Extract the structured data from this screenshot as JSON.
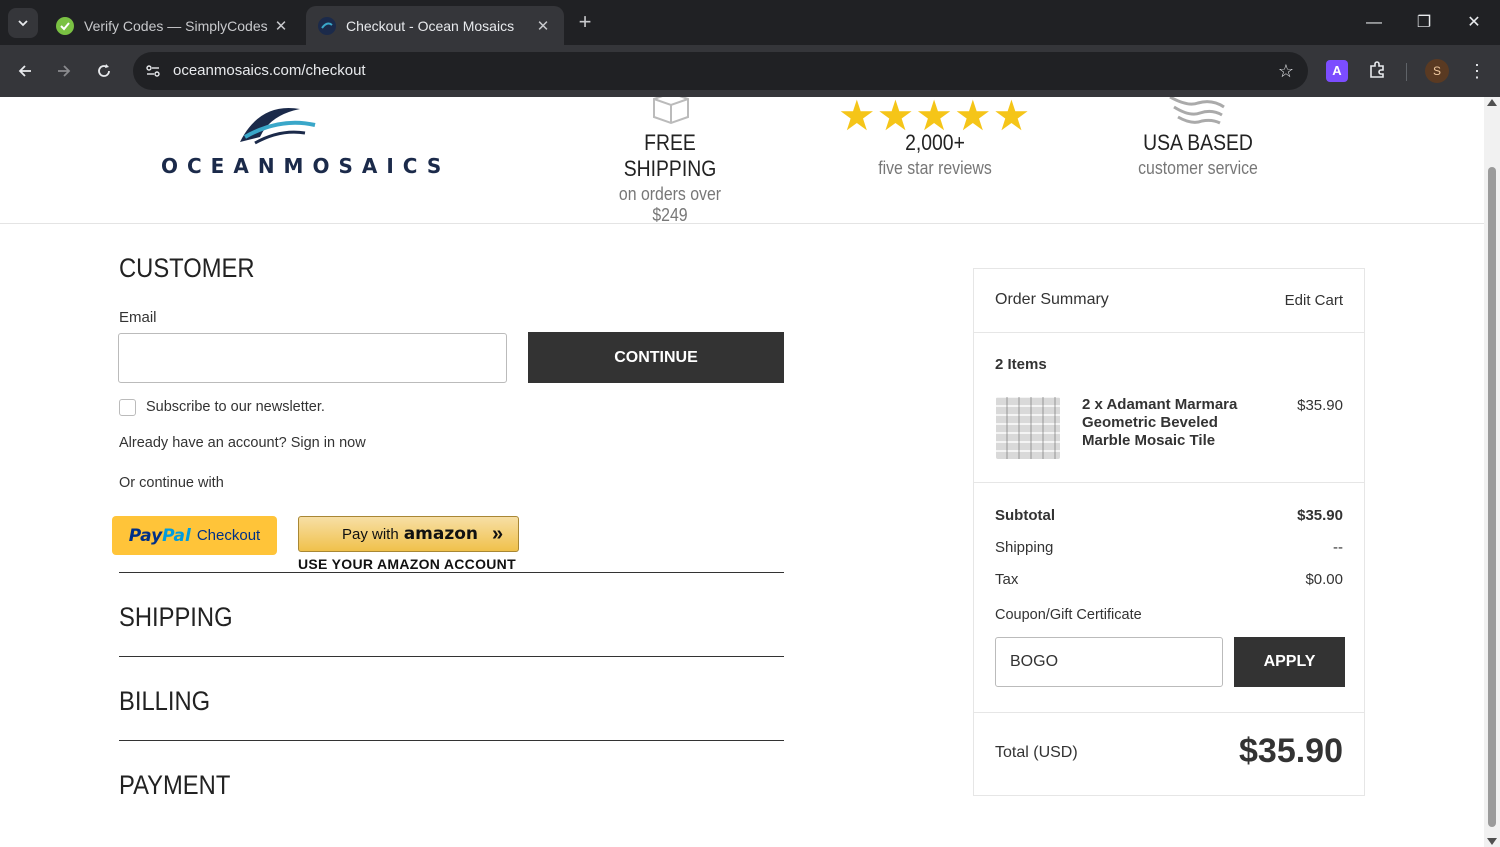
{
  "browser": {
    "tabs": [
      {
        "title": "Verify Codes — SimplyCodes",
        "active": false
      },
      {
        "title": "Checkout - Ocean Mosaics",
        "active": true
      }
    ],
    "url": "oceanmosaics.com/checkout",
    "profile_initial": "S",
    "extension_label": "A"
  },
  "header": {
    "logo_text": "OCEANMOSAICS",
    "features": [
      {
        "title": "FREE SHIPPING",
        "subtitle": "on orders over $249"
      },
      {
        "title": "2,000+",
        "subtitle": "five star reviews",
        "stars": "★★★★★"
      },
      {
        "title": "USA BASED",
        "subtitle": "customer service"
      }
    ]
  },
  "customer": {
    "title": "CUSTOMER",
    "email_label": "Email",
    "email_value": "",
    "continue_label": "CONTINUE",
    "newsletter_label": "Subscribe to our newsletter.",
    "signin_text": "Already have an account? Sign in now",
    "or_continue": "Or continue with",
    "paypal": {
      "part1": "Pay",
      "part2": "Pal",
      "part3": "Checkout"
    },
    "amazon": {
      "pay_with": "Pay with",
      "brand": "amazon",
      "sub": "USE YOUR AMAZON ACCOUNT"
    }
  },
  "sections": {
    "shipping": "SHIPPING",
    "billing": "BILLING",
    "payment": "PAYMENT"
  },
  "summary": {
    "title": "Order Summary",
    "edit_cart": "Edit Cart",
    "items_count": "2 Items",
    "item": {
      "name": "2 x Adamant Marmara Geometric Beveled Marble Mosaic Tile",
      "price": "$35.90"
    },
    "subtotal_label": "Subtotal",
    "subtotal_value": "$35.90",
    "shipping_label": "Shipping",
    "shipping_value": "--",
    "tax_label": "Tax",
    "tax_value": "$0.00",
    "coupon_label": "Coupon/Gift Certificate",
    "coupon_value": "BOGO",
    "apply_label": "APPLY",
    "total_label": "Total (USD)",
    "total_value": "$35.90"
  }
}
